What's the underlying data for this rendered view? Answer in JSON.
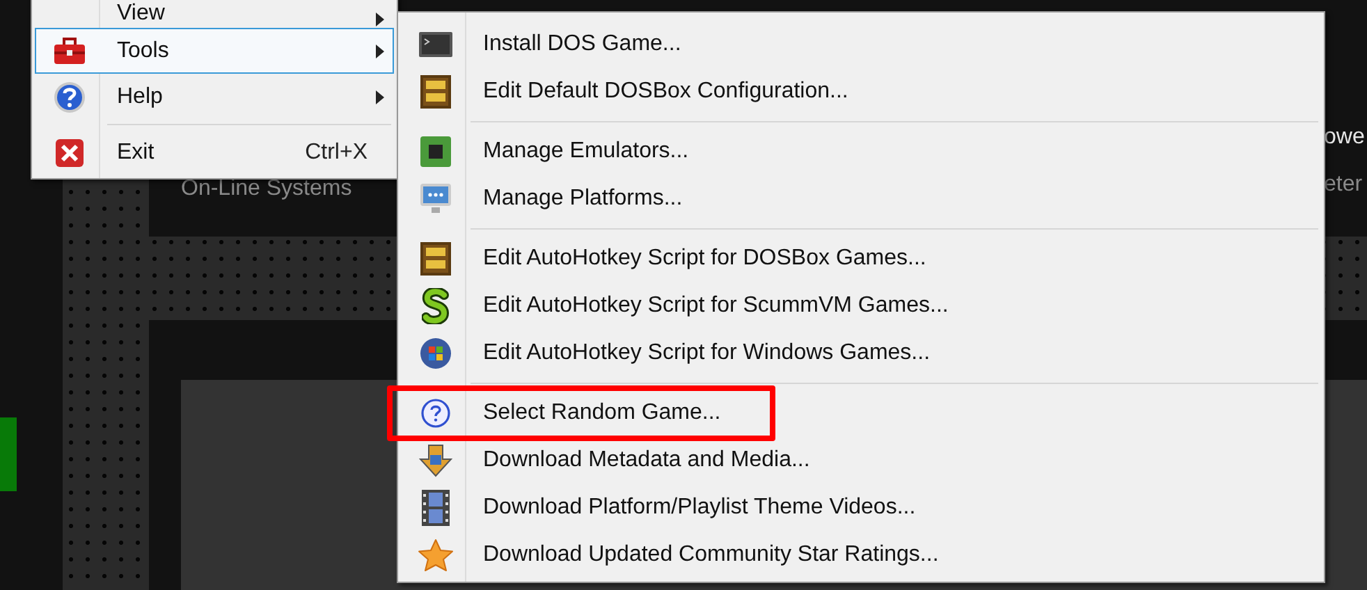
{
  "background": {
    "subtitle": "On-Line Systems",
    "title_fragment": "owe",
    "subtitle_fragment": "eter"
  },
  "menu": {
    "items": [
      {
        "kind": "submenu",
        "label": "View",
        "selected": false
      },
      {
        "kind": "submenu",
        "label": "Tools",
        "selected": true
      },
      {
        "kind": "submenu",
        "label": "Help",
        "selected": false
      },
      {
        "kind": "separator"
      },
      {
        "kind": "command",
        "label": "Exit",
        "shortcut": "Ctrl+X",
        "selected": false
      }
    ]
  },
  "submenu": {
    "items": [
      {
        "kind": "command",
        "label": "Install DOS Game...",
        "highlighted": false
      },
      {
        "kind": "command",
        "label": "Edit Default DOSBox Configuration...",
        "highlighted": false
      },
      {
        "kind": "separator"
      },
      {
        "kind": "command",
        "label": "Manage Emulators...",
        "highlighted": false
      },
      {
        "kind": "command",
        "label": "Manage Platforms...",
        "highlighted": false
      },
      {
        "kind": "separator"
      },
      {
        "kind": "command",
        "label": "Edit AutoHotkey Script for DOSBox Games...",
        "highlighted": false
      },
      {
        "kind": "command",
        "label": "Edit AutoHotkey Script for ScummVM Games...",
        "highlighted": false
      },
      {
        "kind": "command",
        "label": "Edit AutoHotkey Script for Windows Games...",
        "highlighted": false
      },
      {
        "kind": "separator"
      },
      {
        "kind": "command",
        "label": "Select Random Game...",
        "highlighted": true
      },
      {
        "kind": "command",
        "label": "Download Metadata and Media...",
        "highlighted": false
      },
      {
        "kind": "command",
        "label": "Download Platform/Playlist Theme Videos...",
        "highlighted": false
      },
      {
        "kind": "command",
        "label": "Download Updated Community Star Ratings...",
        "highlighted": false
      }
    ]
  }
}
